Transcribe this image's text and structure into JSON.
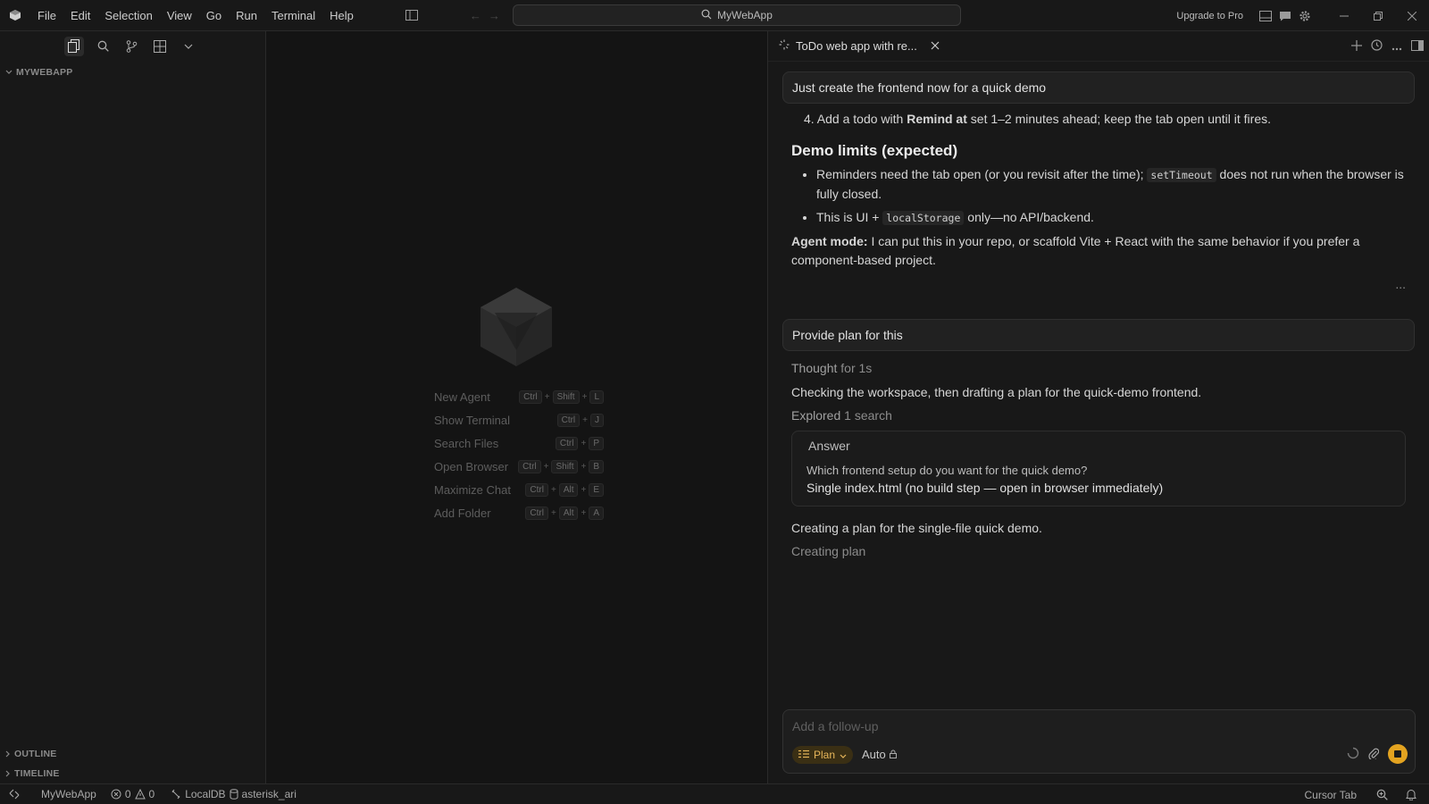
{
  "titlebar": {
    "menu": [
      "File",
      "Edit",
      "Selection",
      "View",
      "Go",
      "Run",
      "Terminal",
      "Help"
    ],
    "search_text": "MyWebApp",
    "upgrade_label": "Upgrade to Pro"
  },
  "sidebar": {
    "section_title": "MYWEBAPP",
    "outline_label": "OUTLINE",
    "timeline_label": "TIMELINE"
  },
  "editor": {
    "shortcuts": [
      {
        "label": "New Agent",
        "keys": [
          "Ctrl",
          "Shift",
          "L"
        ]
      },
      {
        "label": "Show Terminal",
        "keys": [
          "Ctrl",
          "J"
        ]
      },
      {
        "label": "Search Files",
        "keys": [
          "Ctrl",
          "P"
        ]
      },
      {
        "label": "Open Browser",
        "keys": [
          "Ctrl",
          "Shift",
          "B"
        ]
      },
      {
        "label": "Maximize Chat",
        "keys": [
          "Ctrl",
          "Alt",
          "E"
        ]
      },
      {
        "label": "Add Folder",
        "keys": [
          "Ctrl",
          "Alt",
          "A"
        ]
      }
    ]
  },
  "chat": {
    "tab_title": "ToDo web app with re...",
    "user_msg_1": "Just create the frontend now for a quick demo",
    "step4_prefix": "4. Add a todo with ",
    "step4_bold": "Remind at",
    "step4_suffix": " set 1–2 minutes ahead; keep the tab open until it fires.",
    "limits_heading": "Demo limits (expected)",
    "bullet1_a": "Reminders need the tab open (or you revisit after the time); ",
    "bullet1_code": "setTimeout",
    "bullet1_b": " does not run when the browser is fully closed.",
    "bullet2_a": "This is UI + ",
    "bullet2_code": "localStorage",
    "bullet2_b": " only—no API/backend.",
    "agent_mode_bold": "Agent mode:",
    "agent_mode_text": " I can put this in your repo, or scaffold Vite + React with the same behavior if you prefer a component-based project.",
    "more_dots": "...",
    "user_msg_2": "Provide plan for this",
    "thought_label": "Thought",
    "thought_time": "for 1s",
    "checking_text": "Checking the workspace, then drafting a plan for the quick-demo frontend.",
    "explored_label": "Explored",
    "explored_detail": "1 search",
    "answer_title": "Answer",
    "answer_question": "Which frontend setup do you want for the quick demo?",
    "answer_choice": "Single index.html (no build step — open in browser immediately)",
    "creating_text": "Creating a plan for the single-file quick demo.",
    "creating_status": "Creating plan",
    "composer_placeholder": "Add a follow-up",
    "mode_label": "Plan",
    "model_label": "Auto"
  },
  "statusbar": {
    "project": "MyWebApp",
    "errors": "0",
    "warnings": "0",
    "db": "LocalDB",
    "user": "asterisk_ari",
    "cursor_tab": "Cursor Tab"
  },
  "colors": {
    "accent": "#e3a320",
    "plan_pill_text": "#e7b65a",
    "background": "#141414"
  }
}
